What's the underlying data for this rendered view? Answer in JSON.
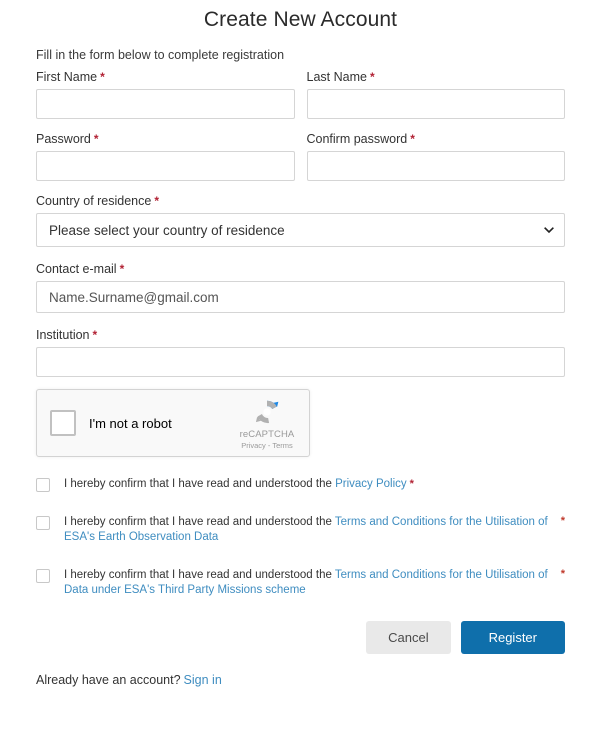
{
  "page": {
    "title": "Create New Account",
    "intro": "Fill in the form below to complete registration",
    "required_mark": "*"
  },
  "fields": {
    "first_name": {
      "label": "First Name",
      "value": "",
      "placeholder": ""
    },
    "last_name": {
      "label": "Last Name",
      "value": "",
      "placeholder": ""
    },
    "password": {
      "label": "Password",
      "value": "",
      "placeholder": ""
    },
    "confirm_password": {
      "label": "Confirm password",
      "value": "",
      "placeholder": ""
    },
    "country": {
      "label": "Country of residence",
      "selected": "Please select your country of residence",
      "options": [
        "Please select your country of residence"
      ]
    },
    "email": {
      "label": "Contact e-mail",
      "value": "",
      "placeholder": "Name.Surname@gmail.com"
    },
    "institution": {
      "label": "Institution",
      "value": "",
      "placeholder": ""
    }
  },
  "recaptcha": {
    "checkbox_label": "I'm not a robot",
    "brand": "reCAPTCHA",
    "legal": "Privacy - Terms",
    "logo_icon": "recaptcha-logo-icon"
  },
  "consents": [
    {
      "prefix": "I hereby confirm that I have read and understood the ",
      "link": "Privacy Policy",
      "suffix": "",
      "required_inline": true,
      "required_right": false
    },
    {
      "prefix": "I hereby confirm that I have read and understood the ",
      "link": "Terms and Conditions for the Utilisation of ESA's Earth Observation Data",
      "suffix": "",
      "required_inline": false,
      "required_right": true
    },
    {
      "prefix": "I hereby confirm that I have read and understood the ",
      "link": "Terms and Conditions for the Utilisation of Data under ESA's Third Party Missions scheme",
      "suffix": "",
      "required_inline": false,
      "required_right": true
    }
  ],
  "buttons": {
    "cancel": "Cancel",
    "register": "Register"
  },
  "footer": {
    "text": "Already have an account?",
    "link": "Sign in"
  },
  "colors": {
    "accent_blue": "#0f6fab",
    "link_blue": "#3f8dc0",
    "required_red": "#b22234",
    "border_gray": "#d5d5d5",
    "cancel_gray": "#e9e9e9"
  }
}
